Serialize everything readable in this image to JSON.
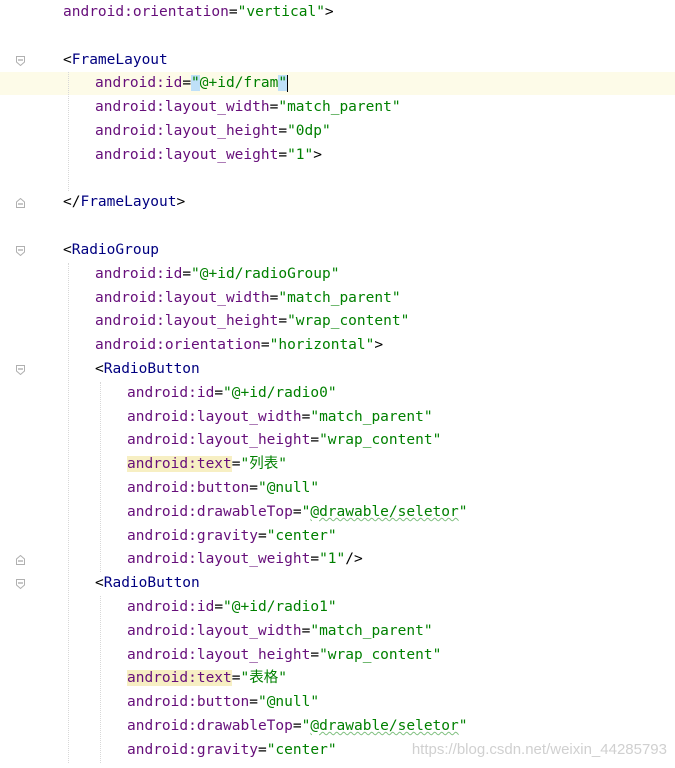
{
  "editor": {
    "lines": [
      {
        "indent": 1,
        "kind": "attr",
        "attr": "android:orientation",
        "value": "vertical",
        "close": ">"
      },
      {
        "indent": 0,
        "kind": "blank"
      },
      {
        "indent": 1,
        "kind": "open",
        "tag": "FrameLayout"
      },
      {
        "indent": 2,
        "kind": "attr",
        "attr": "android:id",
        "value": "@+id/fram",
        "current": true,
        "cursor": true
      },
      {
        "indent": 2,
        "kind": "attr",
        "attr": "android:layout_width",
        "value": "match_parent"
      },
      {
        "indent": 2,
        "kind": "attr",
        "attr": "android:layout_height",
        "value": "0dp"
      },
      {
        "indent": 2,
        "kind": "attr",
        "attr": "android:layout_weight",
        "value": "1",
        "close": ">"
      },
      {
        "indent": 0,
        "kind": "blank"
      },
      {
        "indent": 1,
        "kind": "close",
        "tag": "FrameLayout"
      },
      {
        "indent": 0,
        "kind": "blank"
      },
      {
        "indent": 1,
        "kind": "open",
        "tag": "RadioGroup"
      },
      {
        "indent": 2,
        "kind": "attr",
        "attr": "android:id",
        "value": "@+id/radioGroup"
      },
      {
        "indent": 2,
        "kind": "attr",
        "attr": "android:layout_width",
        "value": "match_parent"
      },
      {
        "indent": 2,
        "kind": "attr",
        "attr": "android:layout_height",
        "value": "wrap_content"
      },
      {
        "indent": 2,
        "kind": "attr",
        "attr": "android:orientation",
        "value": "horizontal",
        "close": ">"
      },
      {
        "indent": 2,
        "kind": "open",
        "tag": "RadioButton"
      },
      {
        "indent": 3,
        "kind": "attr",
        "attr": "android:id",
        "value": "@+id/radio0"
      },
      {
        "indent": 3,
        "kind": "attr",
        "attr": "android:layout_width",
        "value": "match_parent"
      },
      {
        "indent": 3,
        "kind": "attr",
        "attr": "android:layout_height",
        "value": "wrap_content"
      },
      {
        "indent": 3,
        "kind": "attr",
        "attr": "android:text",
        "value": "列表",
        "highlight": true
      },
      {
        "indent": 3,
        "kind": "attr",
        "attr": "android:button",
        "value": "@null"
      },
      {
        "indent": 3,
        "kind": "attr",
        "attr": "android:drawableTop",
        "value": "@drawable/seletor",
        "squiggle": true
      },
      {
        "indent": 3,
        "kind": "attr",
        "attr": "android:gravity",
        "value": "center"
      },
      {
        "indent": 3,
        "kind": "attr",
        "attr": "android:layout_weight",
        "value": "1",
        "close": "/>"
      },
      {
        "indent": 2,
        "kind": "open",
        "tag": "RadioButton"
      },
      {
        "indent": 3,
        "kind": "attr",
        "attr": "android:id",
        "value": "@+id/radio1"
      },
      {
        "indent": 3,
        "kind": "attr",
        "attr": "android:layout_width",
        "value": "match_parent"
      },
      {
        "indent": 3,
        "kind": "attr",
        "attr": "android:layout_height",
        "value": "wrap_content"
      },
      {
        "indent": 3,
        "kind": "attr",
        "attr": "android:text",
        "value": "表格",
        "highlight": true
      },
      {
        "indent": 3,
        "kind": "attr",
        "attr": "android:button",
        "value": "@null"
      },
      {
        "indent": 3,
        "kind": "attr",
        "attr": "android:drawableTop",
        "value": "@drawable/seletor",
        "squiggle": true
      },
      {
        "indent": 3,
        "kind": "attr",
        "attr": "android:gravity",
        "value": "center"
      }
    ]
  },
  "watermark": "https://blog.csdn.net/weixin_44285793",
  "colors": {
    "tag": "#000080",
    "attribute": "#660e7a",
    "value": "#008000",
    "current_line": "#fdfbe8",
    "attr_highlight": "#f7efc3"
  }
}
